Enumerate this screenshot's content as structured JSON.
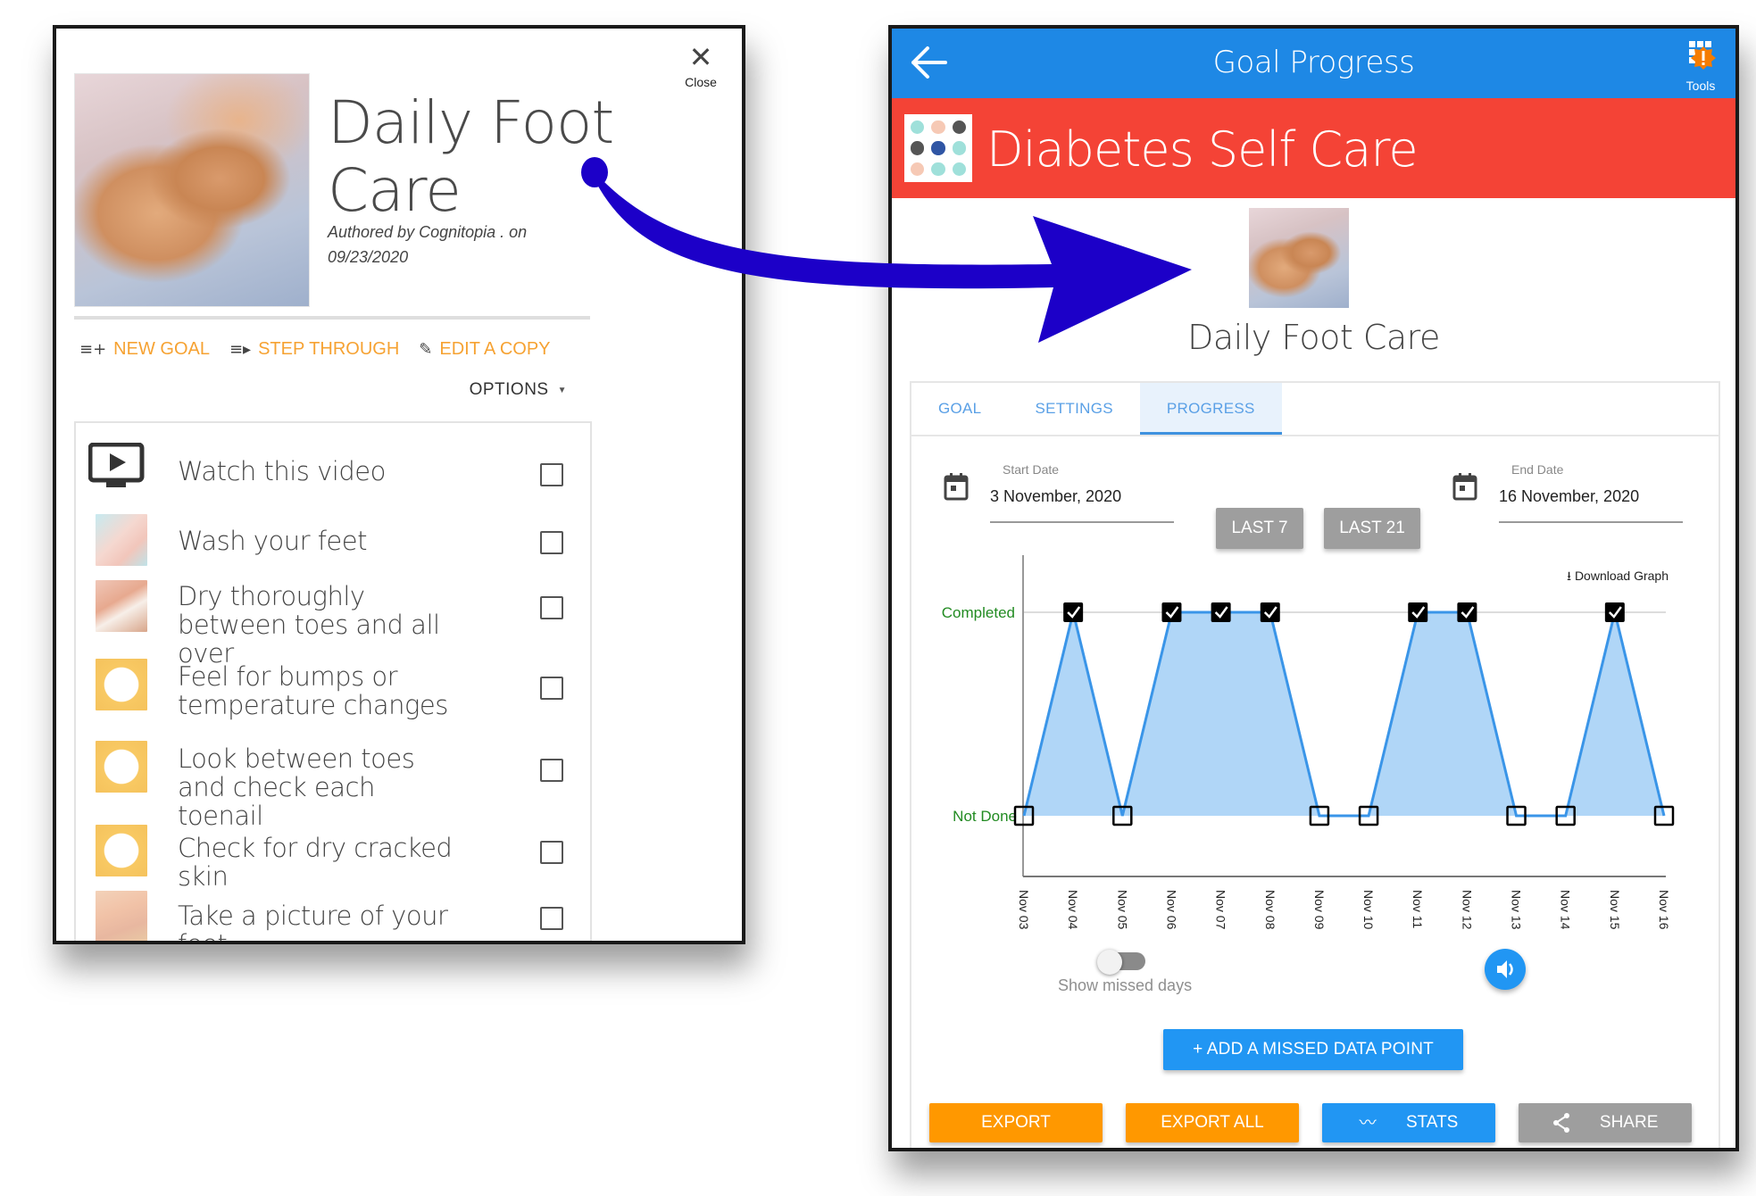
{
  "left_panel": {
    "close_label": "Close",
    "close_icon": "close-icon",
    "title": "Daily Foot Care",
    "author_line": "Authored by Cognitopia . on 09/23/2020",
    "actions": [
      {
        "label": "NEW GOAL",
        "icon": "playlist-add-icon",
        "glyph": "≡+"
      },
      {
        "label": "STEP THROUGH",
        "icon": "playlist-play-icon",
        "glyph": "≡▸"
      },
      {
        "label": "EDIT A COPY",
        "icon": "pencil-icon",
        "glyph": "✎"
      }
    ],
    "options_label": "OPTIONS",
    "steps": [
      {
        "text": "Watch this video",
        "thumb": "video-tv-icon",
        "checked": false
      },
      {
        "text": "Wash your feet",
        "thumb": "wash-feet-image",
        "checked": false
      },
      {
        "text": "Dry thoroughly between toes and all over",
        "thumb": "dry-feet-image",
        "checked": false
      },
      {
        "text": "Feel for bumps or temperature changes",
        "thumb": "feel-bumps-image",
        "checked": false
      },
      {
        "text": "Look between toes and check each toenail",
        "thumb": "look-toes-image",
        "checked": false
      },
      {
        "text": "Check for dry cracked skin",
        "thumb": "dry-skin-image",
        "checked": false
      },
      {
        "text": "Take a picture of your feet",
        "thumb": "feet-photo-image",
        "checked": false
      }
    ]
  },
  "right_panel": {
    "app_title": "Goal Progress",
    "tools_label": "Tools",
    "category_title": "Diabetes Self Care",
    "goal_name": "Daily Foot Care",
    "tabs": [
      {
        "label": "GOAL",
        "active": false
      },
      {
        "label": "SETTINGS",
        "active": false
      },
      {
        "label": "PROGRESS",
        "active": true
      }
    ],
    "start_date_label": "Start Date",
    "start_date_value": "3 November, 2020",
    "end_date_label": "End Date",
    "end_date_value": "16 November, 2020",
    "range_buttons": [
      "LAST 7",
      "LAST 21"
    ],
    "download_label": "Download Graph",
    "toggle_label": "Show missed days",
    "toggle_on": false,
    "add_missed_label": "+ ADD A MISSED DATA POINT",
    "bottom_buttons": [
      {
        "label": "EXPORT",
        "icon": "",
        "color": "#ff9800"
      },
      {
        "label": "EXPORT ALL",
        "icon": "",
        "color": "#ff9800"
      },
      {
        "label": "STATS",
        "icon": "trend-icon",
        "color": "#2196f3"
      },
      {
        "label": "SHARE",
        "icon": "share-icon",
        "color": "#9e9e9e"
      }
    ],
    "colors": {
      "app_bar": "#1e88e5",
      "category_band": "#f44336",
      "accent_orange": "#f6a232",
      "series_line": "#3a95e8",
      "series_fill": "#b0d6f7",
      "y_label_green": "#228b22"
    }
  },
  "chart_data": {
    "type": "area",
    "title": "",
    "xlabel": "",
    "ylabel": "",
    "categories": [
      "Nov 03",
      "Nov 04",
      "Nov 05",
      "Nov 06",
      "Nov 07",
      "Nov 08",
      "Nov 09",
      "Nov 10",
      "Nov 11",
      "Nov 12",
      "Nov 13",
      "Nov 14",
      "Nov 15",
      "Nov 16"
    ],
    "y_tick_labels": [
      "Not Done",
      "Completed"
    ],
    "ylim": [
      0,
      1
    ],
    "series": [
      {
        "name": "Daily Foot Care",
        "values": [
          0,
          1,
          0,
          1,
          1,
          1,
          0,
          0,
          1,
          1,
          0,
          0,
          1,
          0
        ]
      }
    ],
    "marker_completed": "checked-box",
    "marker_not_done": "empty-box",
    "grid": true,
    "legend": "none"
  }
}
